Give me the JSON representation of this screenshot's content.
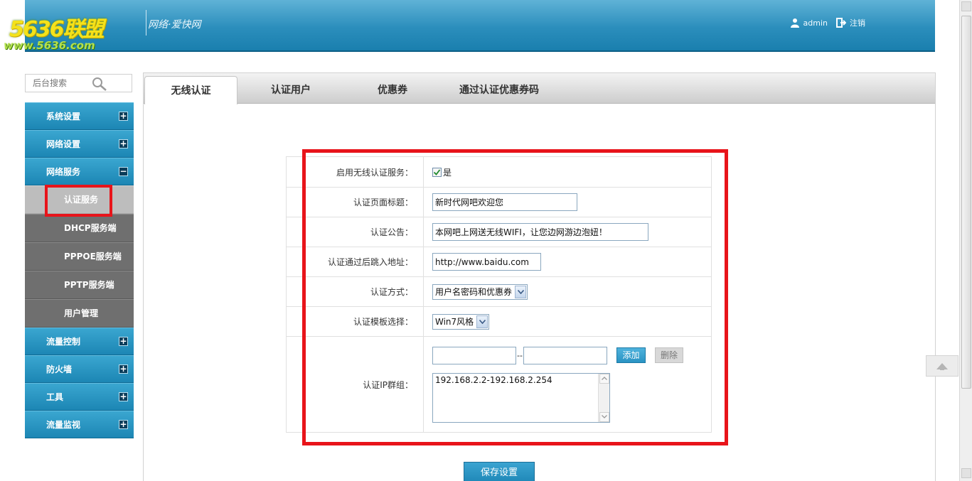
{
  "header": {
    "logo_text": "5636联盟",
    "logo_url": "www.5636.com",
    "slogan": "网络·爱快网",
    "user_name": "admin",
    "logout_label": "注销"
  },
  "sidebar": {
    "search_placeholder": "后台搜索",
    "menu": [
      {
        "label": "系统设置",
        "toggle": "+"
      },
      {
        "label": "网络设置",
        "toggle": "+"
      },
      {
        "label": "网络服务",
        "toggle": "−"
      }
    ],
    "submenu": [
      {
        "label": "认证服务",
        "active": true
      },
      {
        "label": "DHCP服务端",
        "active": false
      },
      {
        "label": "PPPOE服务端",
        "active": false
      },
      {
        "label": "PPTP服务端",
        "active": false
      },
      {
        "label": "用户管理",
        "active": false
      }
    ],
    "menu_after": [
      {
        "label": "流量控制",
        "toggle": "+"
      },
      {
        "label": "防火墙",
        "toggle": "+"
      },
      {
        "label": "工具",
        "toggle": "+"
      },
      {
        "label": "流量监视",
        "toggle": "+"
      }
    ]
  },
  "tabs": [
    {
      "label": "无线认证",
      "active": true
    },
    {
      "label": "认证用户",
      "active": false
    },
    {
      "label": "优惠券",
      "active": false
    },
    {
      "label": "通过认证优惠券码",
      "active": false
    }
  ],
  "form": {
    "enable_label": "启用无线认证服务：",
    "enable_value": "是",
    "enable_checked": true,
    "title_label": "认证页面标题：",
    "title_value": "新时代网吧欢迎您",
    "notice_label": "认证公告：",
    "notice_value": "本网吧上网送无线WIFI，让您边网游边泡妞！",
    "redirect_label": "认证通过后跳入地址：",
    "redirect_value": "http://www.baidu.com",
    "method_label": "认证方式：",
    "method_value": "用户名密码和优惠券",
    "template_label": "认证模板选择：",
    "template_value": "Win7风格",
    "ip_group_label": "认证IP群组：",
    "ip_start_value": "",
    "ip_end_value": "",
    "ip_range_sep": "--",
    "add_label": "添加",
    "delete_label": "删除",
    "ip_list_value": "192.168.2.2-192.168.2.254"
  },
  "save_label": "保存设置",
  "colors": {
    "header_blue": "#2b8ebc",
    "highlight_red": "#e8141a",
    "nav_blue": "#1c86b4",
    "submenu_gray": "#6f6f6f"
  }
}
